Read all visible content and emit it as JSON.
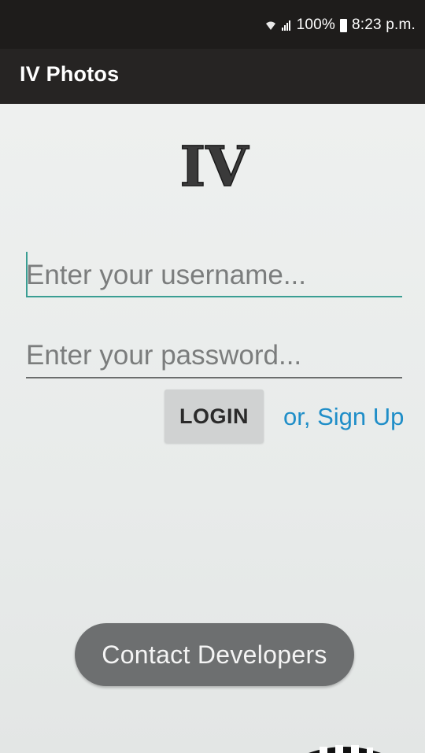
{
  "status_bar": {
    "battery": "100%",
    "time": "8:23 p.m."
  },
  "app_bar": {
    "title": "IV Photos"
  },
  "logo": {
    "text": "IV"
  },
  "login_form": {
    "username_placeholder": "Enter your username...",
    "username_value": "",
    "password_placeholder": "Enter your password...",
    "password_value": "",
    "login_label": "LOGIN",
    "signup_label": "or, Sign Up"
  },
  "footer": {
    "contact_label": "Contact Developers"
  },
  "colors": {
    "accent": "#3a9e93",
    "link": "#1f8ec8",
    "app_bar": "#262423",
    "contact_button": "#6d6f70"
  }
}
